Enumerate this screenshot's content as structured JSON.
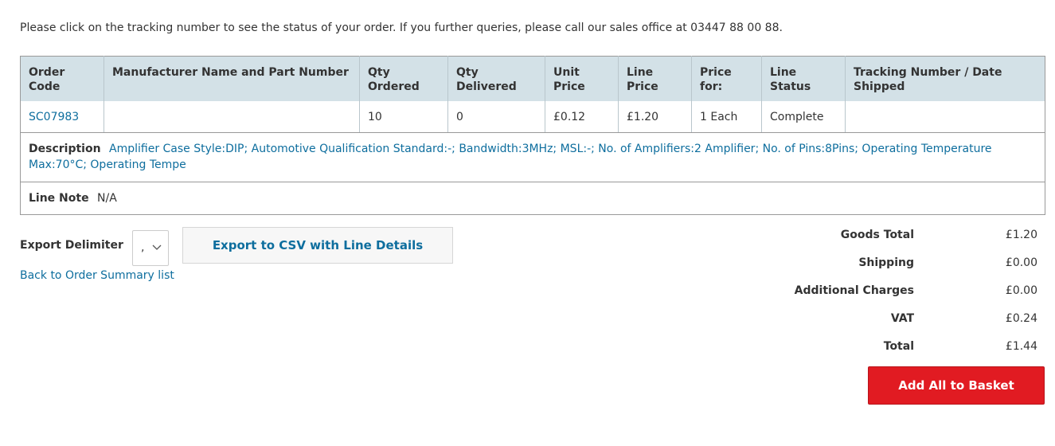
{
  "intro_text": "Please click on the tracking number to see the status of your order. If you further queries, please call our sales office at 03447 88 00 88.",
  "table": {
    "headers": [
      "Order Code",
      "Manufacturer Name and Part Number",
      "Qty Ordered",
      "Qty Delivered",
      "Unit Price",
      "Line Price",
      "Price for:",
      "Line Status",
      "Tracking Number / Date Shipped"
    ],
    "row": {
      "order_code": "SC07983",
      "manufacturer": "",
      "qty_ordered": "10",
      "qty_delivered": "0",
      "unit_price": "£0.12",
      "line_price": "£1.20",
      "price_for": "1 Each",
      "line_status": "Complete",
      "tracking": ""
    },
    "description_label": "Description",
    "description_text": "Amplifier Case Style:DIP; Automotive Qualification Standard:-; Bandwidth:3MHz; MSL:-; No. of Amplifiers:2 Amplifier; No. of Pins:8Pins; Operating Temperature Max:70°C; Operating Tempe",
    "line_note_label": "Line Note",
    "line_note_value": "N/A"
  },
  "export": {
    "delimiter_label": "Export Delimiter",
    "delimiter_value": ",",
    "csv_button": "Export to CSV with Line Details",
    "back_link": "Back to Order Summary list"
  },
  "totals": {
    "goods_total_label": "Goods Total",
    "goods_total_value": "£1.20",
    "shipping_label": "Shipping",
    "shipping_value": "£0.00",
    "additional_label": "Additional Charges",
    "additional_value": "£0.00",
    "vat_label": "VAT",
    "vat_value": "£0.24",
    "total_label": "Total",
    "total_value": "£1.44"
  },
  "basket_button": "Add All to Basket",
  "colors": {
    "link": "#0e6e9e",
    "header_bg": "#d3e1e7",
    "basket_button_bg": "#e11b22"
  },
  "icons": {
    "delimiter_dropdown": "chevron-down-icon"
  }
}
